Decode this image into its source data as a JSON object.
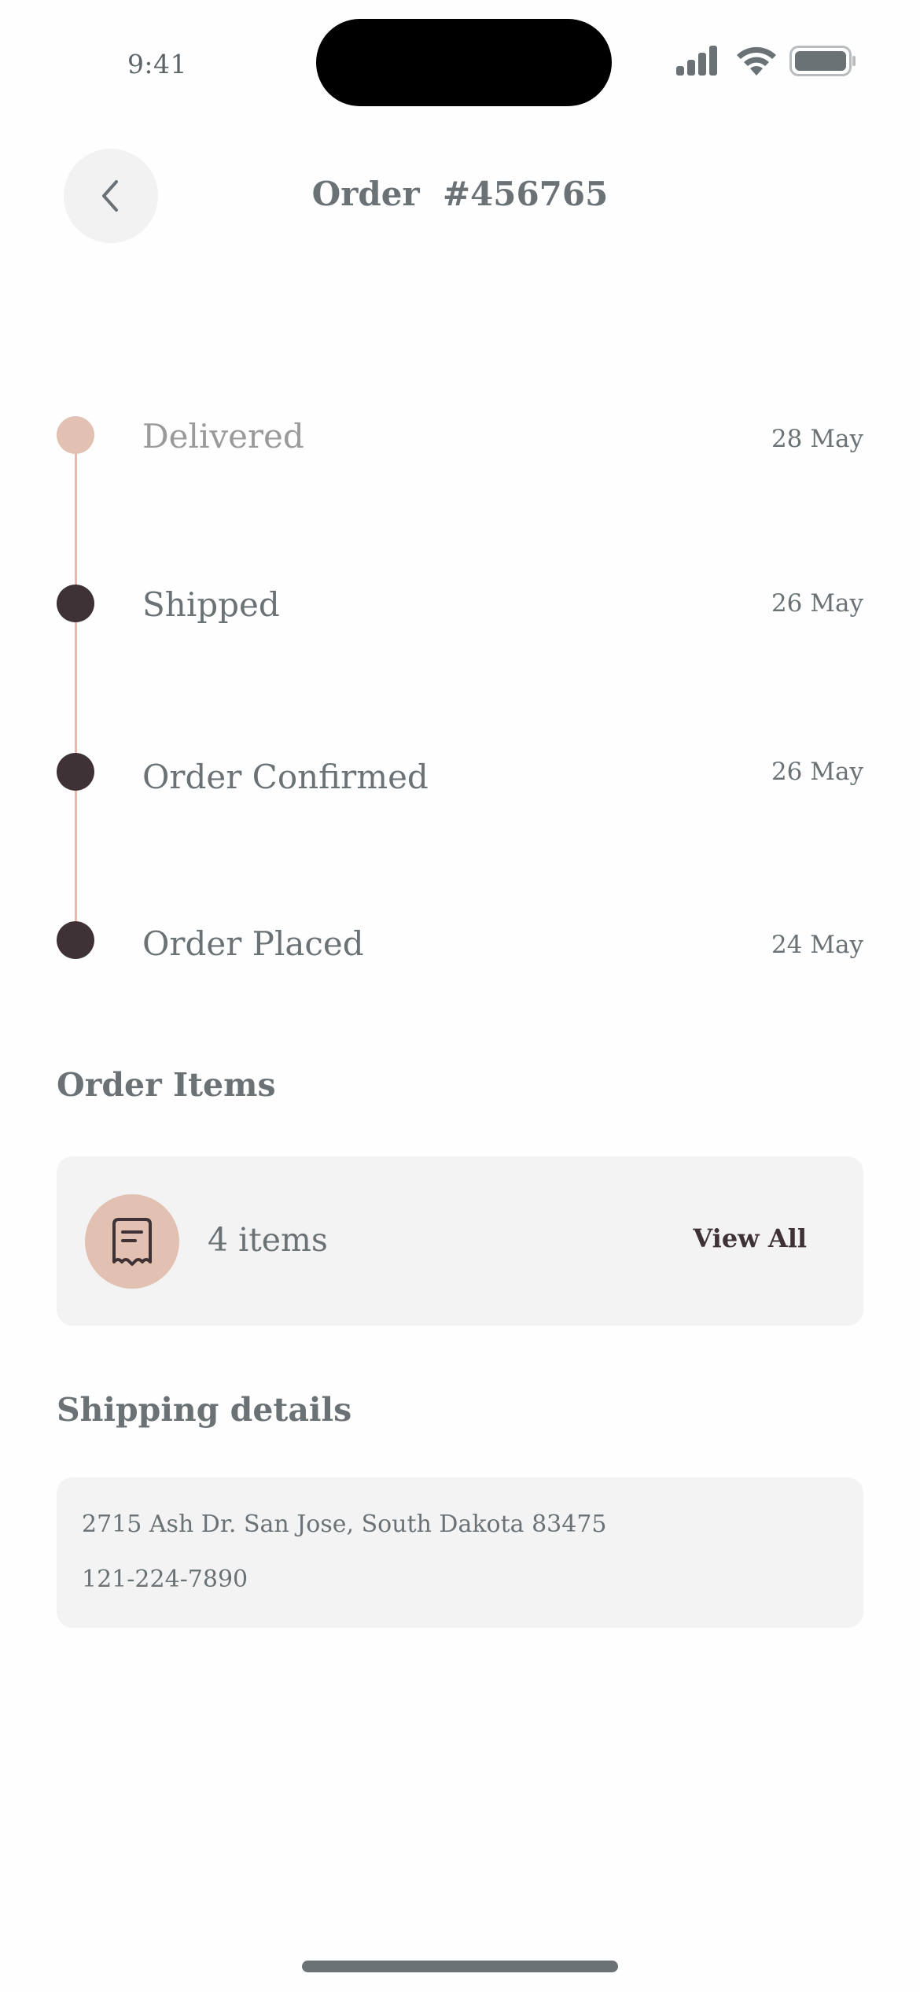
{
  "status_bar": {
    "time": "9:41"
  },
  "header": {
    "title": "Order  #456765"
  },
  "timeline": [
    {
      "label": "Delivered",
      "date": "28 May",
      "active": true
    },
    {
      "label": "Shipped",
      "date": "26 May",
      "active": false
    },
    {
      "label": "Order Confirmed",
      "date": "26 May",
      "active": false
    },
    {
      "label": "Order Placed",
      "date": "24 May",
      "active": false
    }
  ],
  "order_items": {
    "title": "Order Items",
    "count_label": "4 items",
    "view_all_label": "View All"
  },
  "shipping": {
    "title": "Shipping details",
    "address": "2715 Ash Dr. San Jose, South Dakota 83475",
    "phone": "121-224-7890"
  },
  "colors": {
    "accent": "#e2c1b3",
    "dark": "#3e3236",
    "text": "#6b7276",
    "card": "#f3f3f3"
  }
}
